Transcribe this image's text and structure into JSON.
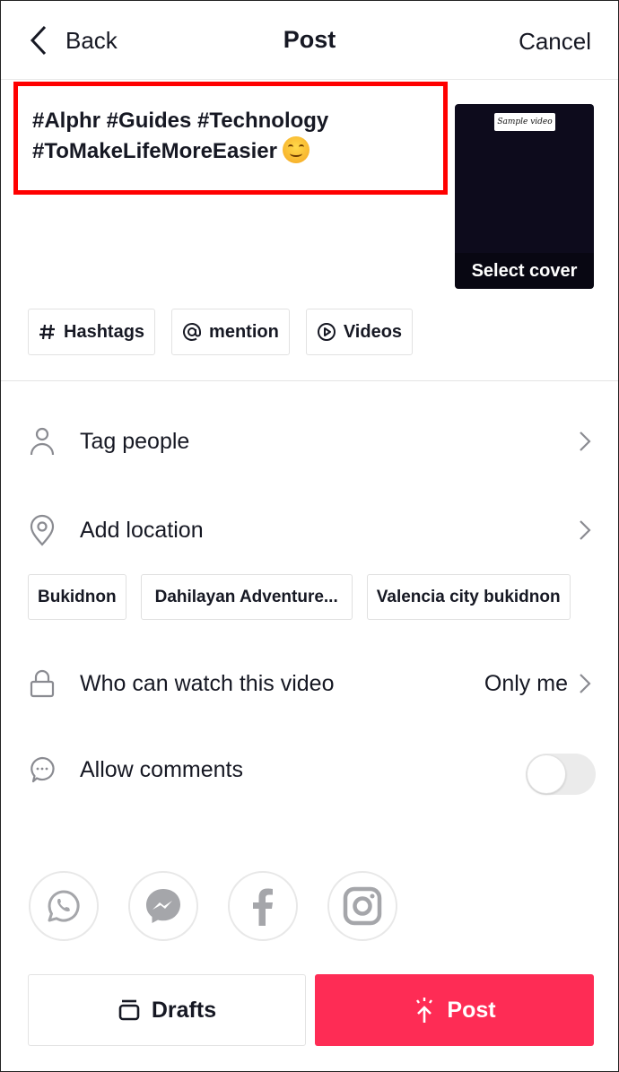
{
  "header": {
    "back_label": "Back",
    "title": "Post",
    "cancel_label": "Cancel"
  },
  "caption": {
    "line1": "#Alphr #Guides #Technology",
    "line2": "#ToMakeLifeMoreEasier",
    "emoji": "smiling-face-emoji",
    "highlight_color": "#ff0000"
  },
  "cover": {
    "overlay_text": "Sample video",
    "select_label": "Select cover"
  },
  "chips": [
    {
      "icon": "hashtag-icon",
      "label": "Hashtags"
    },
    {
      "icon": "at-icon",
      "label": "mention"
    },
    {
      "icon": "play-circle-icon",
      "label": "Videos"
    }
  ],
  "rows": {
    "tag_people": {
      "icon": "person-icon",
      "label": "Tag people"
    },
    "add_location": {
      "icon": "location-pin-icon",
      "label": "Add location"
    },
    "privacy": {
      "icon": "lock-icon",
      "label": "Who can watch this video",
      "value": "Only me"
    },
    "comments": {
      "icon": "comment-icon",
      "label": "Allow comments",
      "enabled": false
    }
  },
  "location_suggestions": [
    "Bukidnon",
    "Dahilayan Adventure...",
    "Valencia city bukidnon"
  ],
  "share_targets": [
    "whatsapp-icon",
    "messenger-icon",
    "facebook-icon",
    "instagram-icon"
  ],
  "actions": {
    "drafts_label": "Drafts",
    "post_label": "Post",
    "post_color": "#fe2c55"
  }
}
